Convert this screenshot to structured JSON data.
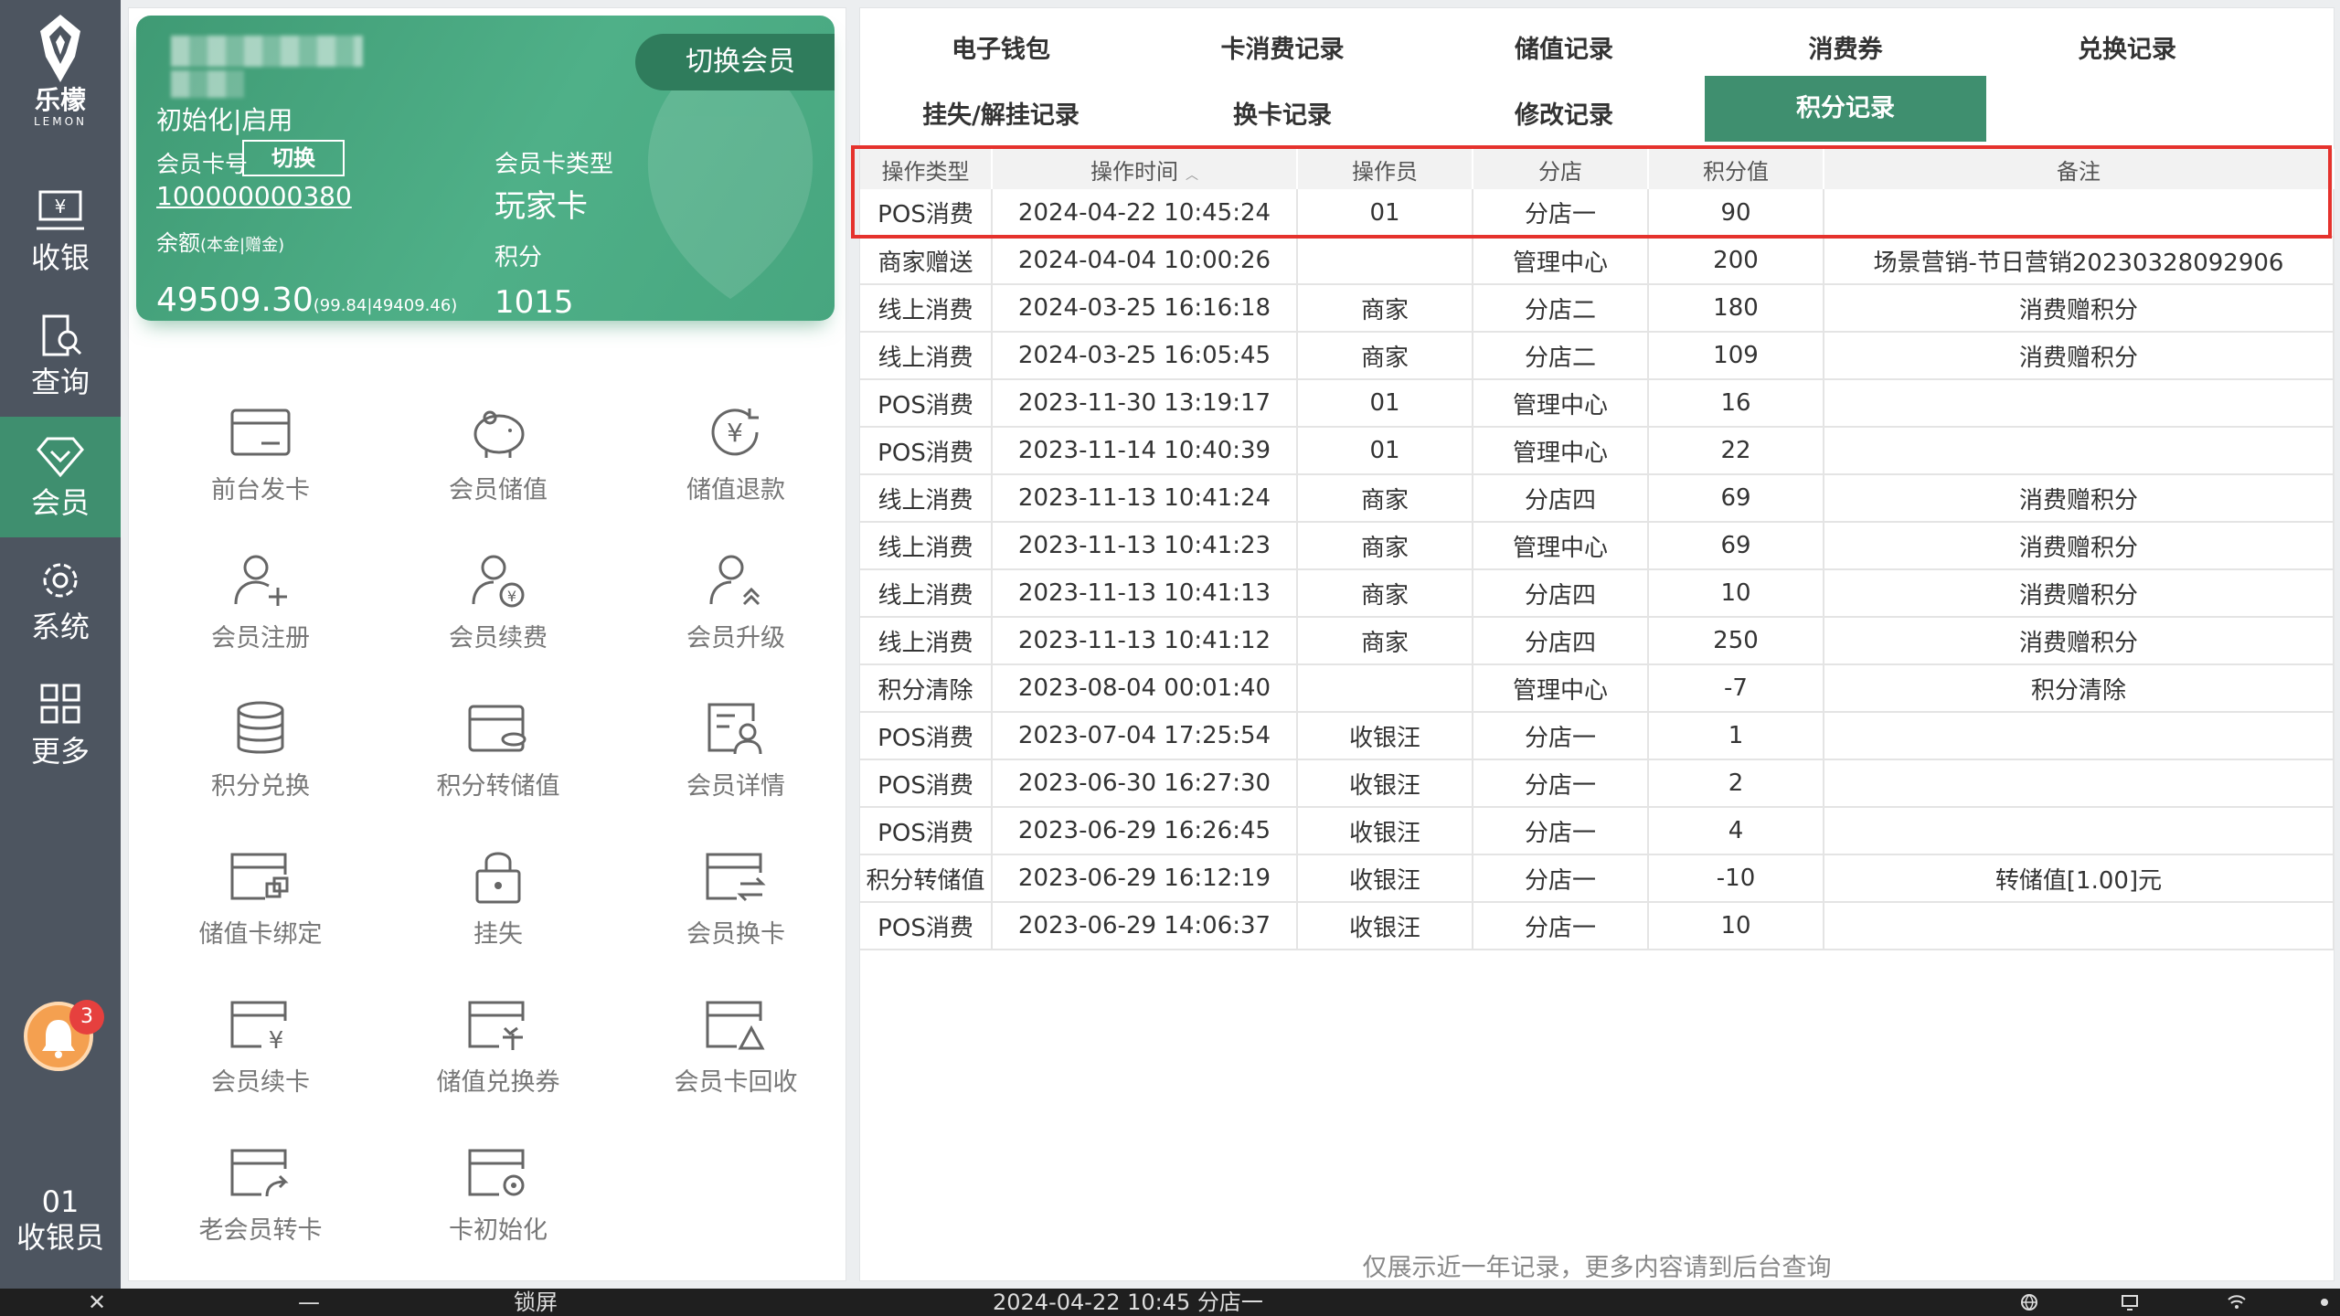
{
  "app": {
    "logo_cn": "乐檬",
    "logo_en": "LEMON"
  },
  "nav": [
    {
      "label": "收银",
      "icon": "cashier-icon"
    },
    {
      "label": "查询",
      "icon": "query-icon"
    },
    {
      "label": "会员",
      "icon": "member-icon",
      "active": true
    },
    {
      "label": "系统",
      "icon": "settings-icon"
    },
    {
      "label": "更多",
      "icon": "more-icon"
    }
  ],
  "notifications": {
    "count": "3"
  },
  "cashier": {
    "no": "01",
    "role": "收银员"
  },
  "card": {
    "switch_member": "切换会员",
    "status": "初始化|启用",
    "card_no_label": "会员卡号",
    "swap_label": "切换",
    "card_no": "100000000380",
    "balance_label": "余额",
    "balance_sub": "(本金|赠金)",
    "balance": "49509.30",
    "balance_detail": "(99.84|49409.46)",
    "type_label": "会员卡类型",
    "type": "玩家卡",
    "points_label": "积分",
    "points": "1015"
  },
  "functions": [
    {
      "label": "前台发卡",
      "icon": "card-icon"
    },
    {
      "label": "会员储值",
      "icon": "piggy-bank-icon"
    },
    {
      "label": "储值退款",
      "icon": "yen-refund-icon"
    },
    {
      "label": "会员注册",
      "icon": "user-add-icon"
    },
    {
      "label": "会员续费",
      "icon": "user-yen-icon"
    },
    {
      "label": "会员升级",
      "icon": "user-upgrade-icon"
    },
    {
      "label": "积分兑换",
      "icon": "database-icon"
    },
    {
      "label": "积分转储值",
      "icon": "wallet-icon"
    },
    {
      "label": "会员详情",
      "icon": "user-detail-icon"
    },
    {
      "label": "储值卡绑定",
      "icon": "card-bind-icon"
    },
    {
      "label": "挂失",
      "icon": "lock-icon"
    },
    {
      "label": "会员换卡",
      "icon": "card-swap-icon"
    },
    {
      "label": "会员续卡",
      "icon": "card-yen-icon"
    },
    {
      "label": "储值兑换券",
      "icon": "card-coupon-icon"
    },
    {
      "label": "会员卡回收",
      "icon": "card-recycle-icon"
    },
    {
      "label": "老会员转卡",
      "icon": "card-transfer-icon"
    },
    {
      "label": "卡初始化",
      "icon": "card-reset-icon"
    }
  ],
  "tabs": [
    {
      "label": "电子钱包"
    },
    {
      "label": "卡消费记录"
    },
    {
      "label": "储值记录"
    },
    {
      "label": "消费券"
    },
    {
      "label": "兑换记录"
    },
    {
      "label": "挂失/解挂记录"
    },
    {
      "label": "换卡记录"
    },
    {
      "label": "修改记录"
    },
    {
      "label": "积分记录",
      "active": true
    }
  ],
  "table": {
    "headers": [
      "操作类型",
      "操作时间",
      "操作员",
      "分店",
      "积分值",
      "备注"
    ],
    "rows": [
      [
        "POS消费",
        "2024-04-22 10:45:24",
        "01",
        "分店一",
        "90",
        ""
      ],
      [
        "商家赠送",
        "2024-04-04 10:00:26",
        "",
        "管理中心",
        "200",
        "场景营销-节日营销20230328092906"
      ],
      [
        "线上消费",
        "2024-03-25 16:16:18",
        "商家",
        "分店二",
        "180",
        "消费赠积分"
      ],
      [
        "线上消费",
        "2024-03-25 16:05:45",
        "商家",
        "分店二",
        "109",
        "消费赠积分"
      ],
      [
        "POS消费",
        "2023-11-30 13:19:17",
        "01",
        "管理中心",
        "16",
        ""
      ],
      [
        "POS消费",
        "2023-11-14 10:40:39",
        "01",
        "管理中心",
        "22",
        ""
      ],
      [
        "线上消费",
        "2023-11-13 10:41:24",
        "商家",
        "分店四",
        "69",
        "消费赠积分"
      ],
      [
        "线上消费",
        "2023-11-13 10:41:23",
        "商家",
        "管理中心",
        "69",
        "消费赠积分"
      ],
      [
        "线上消费",
        "2023-11-13 10:41:13",
        "商家",
        "分店四",
        "10",
        "消费赠积分"
      ],
      [
        "线上消费",
        "2023-11-13 10:41:12",
        "商家",
        "分店四",
        "250",
        "消费赠积分"
      ],
      [
        "积分清除",
        "2023-08-04 00:01:40",
        "",
        "管理中心",
        "-7",
        "积分清除"
      ],
      [
        "POS消费",
        "2023-07-04 17:25:54",
        "收银汪",
        "分店一",
        "1",
        ""
      ],
      [
        "POS消费",
        "2023-06-30 16:27:30",
        "收银汪",
        "分店一",
        "2",
        ""
      ],
      [
        "POS消费",
        "2023-06-29 16:26:45",
        "收银汪",
        "分店一",
        "4",
        ""
      ],
      [
        "积分转储值",
        "2023-06-29 16:12:19",
        "收银汪",
        "分店一",
        "-10",
        "转储值[1.00]元"
      ],
      [
        "POS消费",
        "2023-06-29 14:06:37",
        "收银汪",
        "分店一",
        "10",
        ""
      ]
    ],
    "footer_note": "仅展示近一年记录，更多内容请到后台查询"
  },
  "taskbar": {
    "close": "✕",
    "minimize": "—",
    "lock": "锁屏",
    "datetime": "2024-04-22 10:45 分店一"
  },
  "colors": {
    "accent": "#3f8f6f",
    "nav_bg": "#4d5560",
    "highlight": "#e5322d"
  }
}
